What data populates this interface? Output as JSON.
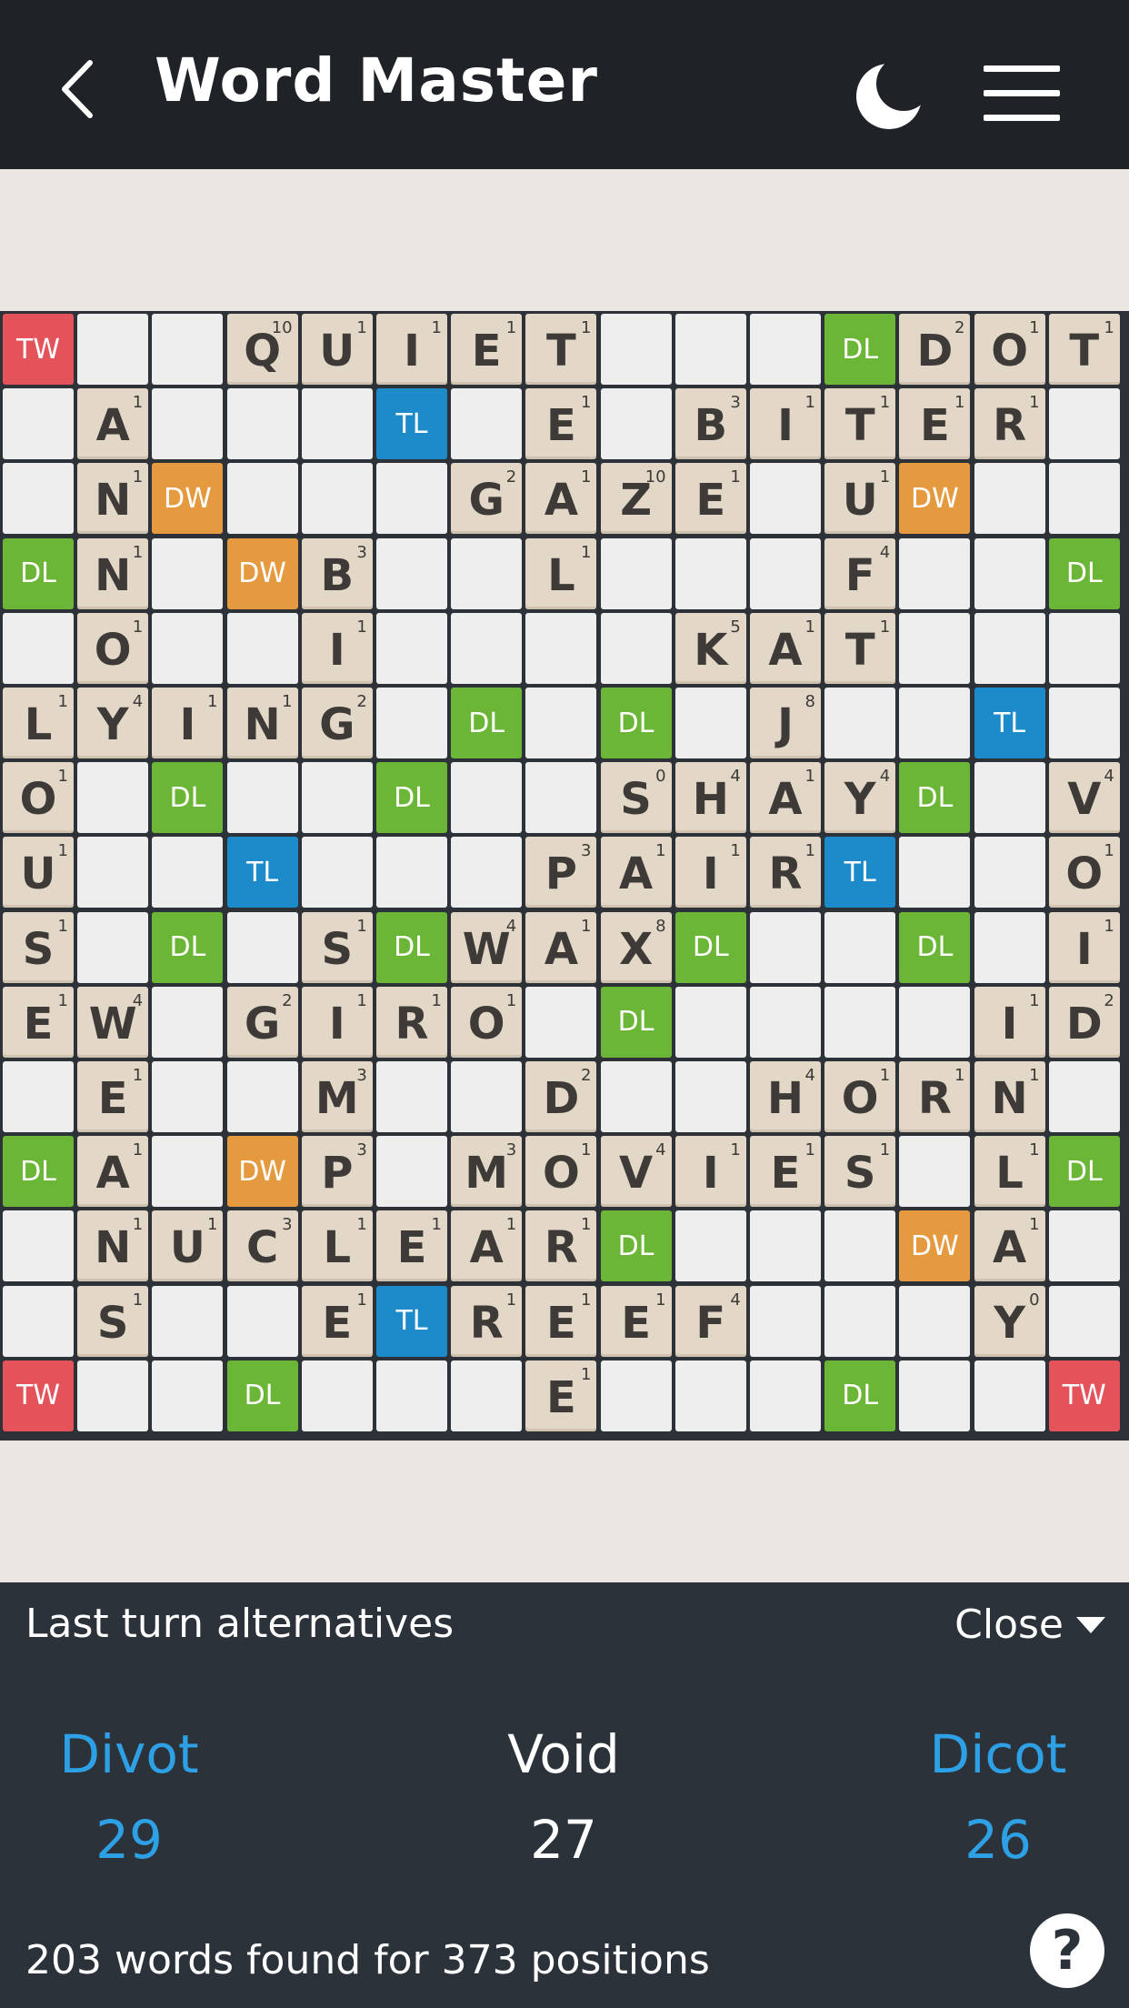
{
  "header": {
    "title": "Word Master"
  },
  "colors": {
    "tw": "#e4535a",
    "dw": "#e59a3f",
    "tl": "#1d8ac9",
    "dl": "#6bb636",
    "tile": "#e3d8c8",
    "recent": "#62baf0",
    "hint": "#7fcf62"
  },
  "board": {
    "bonuses": [
      [
        0,
        0,
        "TW"
      ],
      [
        0,
        11,
        "DL"
      ],
      [
        0,
        14,
        "TW"
      ],
      [
        1,
        5,
        "TL"
      ],
      [
        2,
        2,
        "DW"
      ],
      [
        2,
        12,
        "DW"
      ],
      [
        3,
        0,
        "DL"
      ],
      [
        3,
        3,
        "DW"
      ],
      [
        3,
        14,
        "DL"
      ],
      [
        5,
        6,
        "DL"
      ],
      [
        5,
        8,
        "DL"
      ],
      [
        5,
        13,
        "TL"
      ],
      [
        6,
        2,
        "DL"
      ],
      [
        6,
        5,
        "DL"
      ],
      [
        6,
        12,
        "DL"
      ],
      [
        7,
        3,
        "TL"
      ],
      [
        7,
        11,
        "TL"
      ],
      [
        8,
        2,
        "DL"
      ],
      [
        8,
        5,
        "DL"
      ],
      [
        8,
        9,
        "DL"
      ],
      [
        8,
        12,
        "DL"
      ],
      [
        9,
        8,
        "DL"
      ],
      [
        11,
        0,
        "DL"
      ],
      [
        11,
        3,
        "DW"
      ],
      [
        11,
        14,
        "DL"
      ],
      [
        12,
        8,
        "DL"
      ],
      [
        12,
        12,
        "DW"
      ],
      [
        13,
        5,
        "TL"
      ],
      [
        14,
        0,
        "TW"
      ],
      [
        14,
        3,
        "DL"
      ],
      [
        14,
        11,
        "DL"
      ],
      [
        14,
        14,
        "TW"
      ]
    ],
    "tiles": [
      [
        0,
        3,
        "Q",
        "10"
      ],
      [
        0,
        4,
        "U",
        "1"
      ],
      [
        0,
        5,
        "I",
        "1"
      ],
      [
        0,
        6,
        "E",
        "1"
      ],
      [
        0,
        7,
        "T",
        "1"
      ],
      [
        0,
        12,
        "D",
        "2"
      ],
      [
        0,
        13,
        "O",
        "1"
      ],
      [
        0,
        14,
        "T",
        "1"
      ],
      [
        1,
        1,
        "A",
        "1"
      ],
      [
        1,
        7,
        "E",
        "1"
      ],
      [
        1,
        9,
        "B",
        "3"
      ],
      [
        1,
        10,
        "I",
        "1"
      ],
      [
        1,
        11,
        "T",
        "1"
      ],
      [
        1,
        12,
        "E",
        "1"
      ],
      [
        1,
        13,
        "R",
        "1"
      ],
      [
        2,
        1,
        "N",
        "1"
      ],
      [
        2,
        6,
        "G",
        "2"
      ],
      [
        2,
        7,
        "A",
        "1"
      ],
      [
        2,
        8,
        "Z",
        "10"
      ],
      [
        2,
        9,
        "E",
        "1"
      ],
      [
        2,
        11,
        "U",
        "1"
      ],
      [
        3,
        1,
        "N",
        "1"
      ],
      [
        3,
        4,
        "B",
        "3"
      ],
      [
        3,
        7,
        "L",
        "1"
      ],
      [
        3,
        11,
        "F",
        "4"
      ],
      [
        4,
        1,
        "O",
        "1"
      ],
      [
        4,
        4,
        "I",
        "1"
      ],
      [
        4,
        9,
        "K",
        "5"
      ],
      [
        4,
        10,
        "A",
        "1"
      ],
      [
        4,
        11,
        "T",
        "1"
      ],
      [
        5,
        0,
        "L",
        "1"
      ],
      [
        5,
        1,
        "Y",
        "4"
      ],
      [
        5,
        2,
        "I",
        "1"
      ],
      [
        5,
        3,
        "N",
        "1"
      ],
      [
        5,
        4,
        "G",
        "2"
      ],
      [
        5,
        10,
        "J",
        "8"
      ],
      [
        6,
        0,
        "O",
        "1"
      ],
      [
        6,
        8,
        "S",
        "0",
        "blank"
      ],
      [
        6,
        9,
        "H",
        "4"
      ],
      [
        6,
        10,
        "A",
        "1"
      ],
      [
        6,
        11,
        "Y",
        "4"
      ],
      [
        6,
        14,
        "V",
        "4",
        "",
        "hint"
      ],
      [
        7,
        0,
        "U",
        "1"
      ],
      [
        7,
        7,
        "P",
        "3"
      ],
      [
        7,
        8,
        "A",
        "1"
      ],
      [
        7,
        9,
        "I",
        "1"
      ],
      [
        7,
        10,
        "R",
        "1"
      ],
      [
        7,
        14,
        "O",
        "1",
        "",
        "hint"
      ],
      [
        8,
        0,
        "S",
        "1"
      ],
      [
        8,
        4,
        "S",
        "1"
      ],
      [
        8,
        6,
        "W",
        "4"
      ],
      [
        8,
        7,
        "A",
        "1"
      ],
      [
        8,
        8,
        "X",
        "8"
      ],
      [
        8,
        14,
        "I",
        "1",
        "",
        "hint"
      ],
      [
        9,
        0,
        "E",
        "1"
      ],
      [
        9,
        1,
        "W",
        "4"
      ],
      [
        9,
        3,
        "G",
        "2"
      ],
      [
        9,
        4,
        "I",
        "1"
      ],
      [
        9,
        5,
        "R",
        "1"
      ],
      [
        9,
        6,
        "O",
        "1"
      ],
      [
        9,
        13,
        "I",
        "1"
      ],
      [
        9,
        14,
        "D",
        "2",
        "",
        "hint"
      ],
      [
        10,
        1,
        "E",
        "1"
      ],
      [
        10,
        4,
        "M",
        "3"
      ],
      [
        10,
        7,
        "D",
        "2"
      ],
      [
        10,
        10,
        "H",
        "4"
      ],
      [
        10,
        11,
        "O",
        "1"
      ],
      [
        10,
        12,
        "R",
        "1"
      ],
      [
        10,
        13,
        "N",
        "1"
      ],
      [
        11,
        1,
        "A",
        "1"
      ],
      [
        11,
        4,
        "P",
        "3"
      ],
      [
        11,
        6,
        "M",
        "3"
      ],
      [
        11,
        7,
        "O",
        "1"
      ],
      [
        11,
        8,
        "V",
        "4"
      ],
      [
        11,
        9,
        "I",
        "1"
      ],
      [
        11,
        10,
        "E",
        "1"
      ],
      [
        11,
        11,
        "S",
        "1"
      ],
      [
        11,
        13,
        "L",
        "1"
      ],
      [
        12,
        1,
        "N",
        "1"
      ],
      [
        12,
        2,
        "U",
        "1"
      ],
      [
        12,
        3,
        "C",
        "3"
      ],
      [
        12,
        4,
        "L",
        "1"
      ],
      [
        12,
        5,
        "E",
        "1"
      ],
      [
        12,
        6,
        "A",
        "1"
      ],
      [
        12,
        7,
        "R",
        "1"
      ],
      [
        12,
        13,
        "A",
        "1"
      ],
      [
        13,
        1,
        "S",
        "1"
      ],
      [
        13,
        4,
        "E",
        "1"
      ],
      [
        13,
        6,
        "R",
        "1",
        "",
        "recent"
      ],
      [
        13,
        7,
        "E",
        "1"
      ],
      [
        13,
        8,
        "E",
        "1",
        "",
        "recent"
      ],
      [
        13,
        9,
        "F",
        "4",
        "",
        "recent"
      ],
      [
        13,
        13,
        "Y",
        "0",
        "blank"
      ],
      [
        14,
        7,
        "E",
        "1"
      ]
    ]
  },
  "panel": {
    "title": "Last turn alternatives",
    "close_label": "Close",
    "alternatives": [
      {
        "word": "Divot",
        "score": "29"
      },
      {
        "word": "Void",
        "score": "27"
      },
      {
        "word": "Dicot",
        "score": "26"
      }
    ],
    "footer": "203 words found for 373 positions",
    "help_label": "?"
  }
}
